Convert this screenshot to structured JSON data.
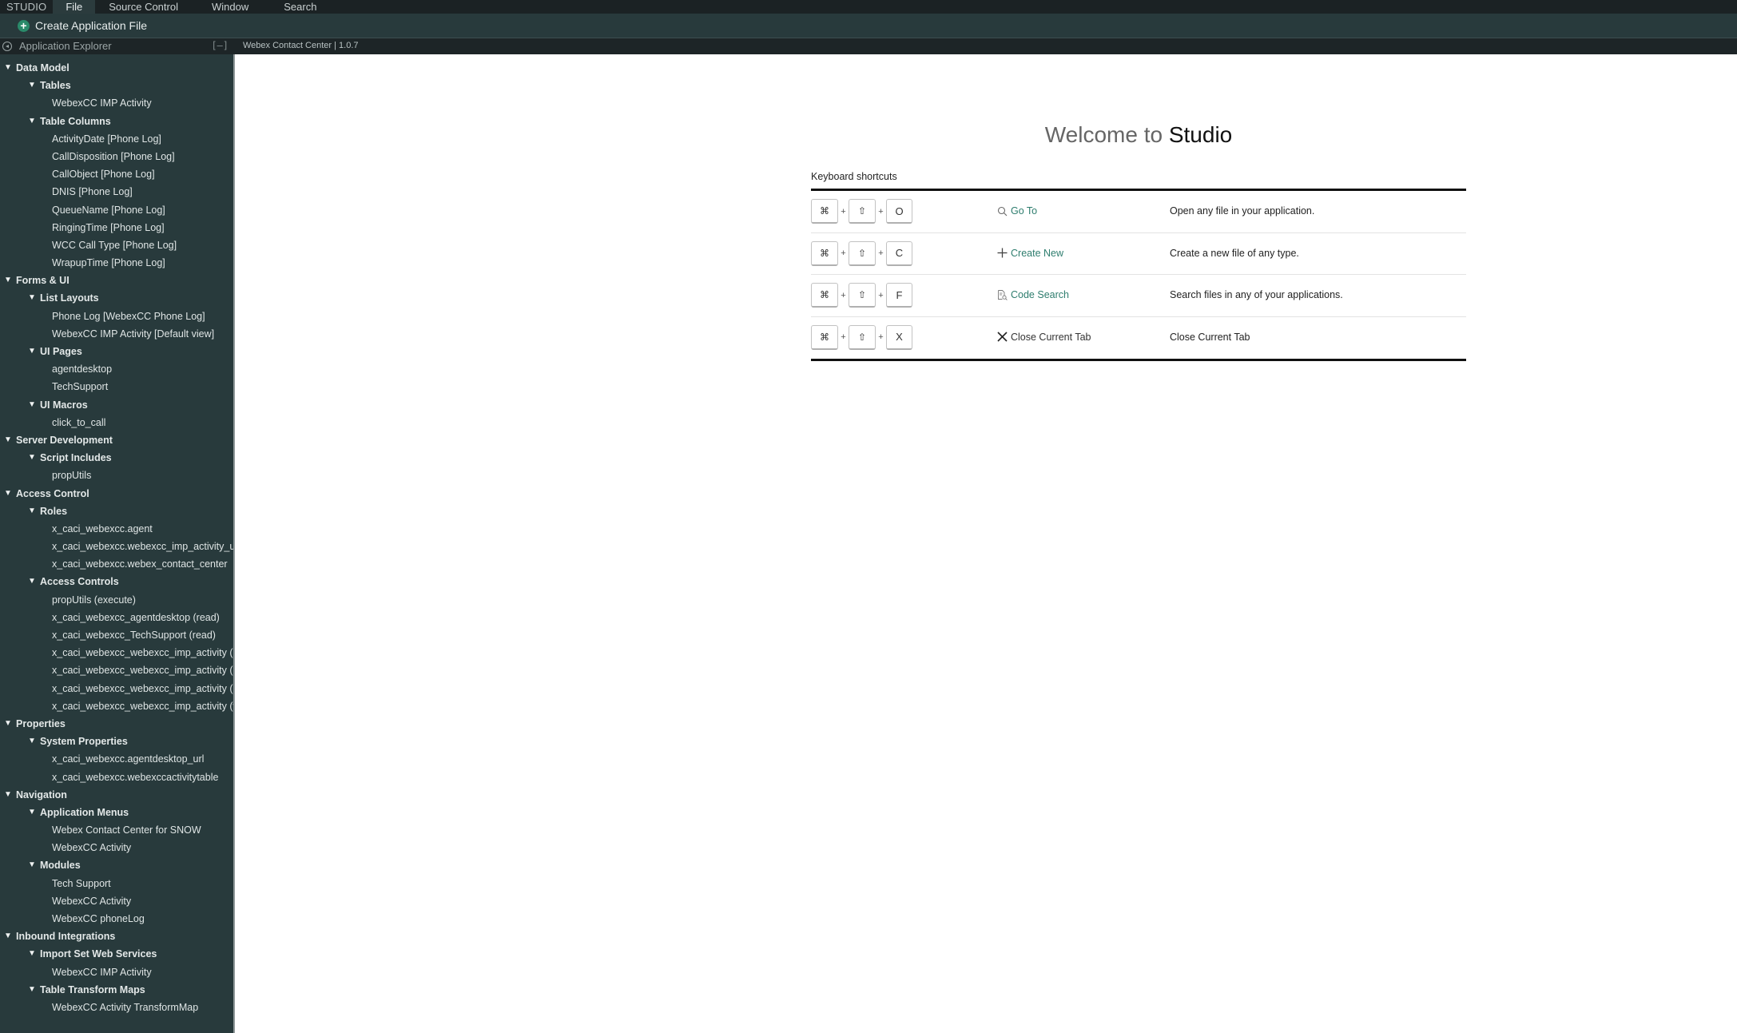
{
  "menubar": {
    "brand": "STUDIO",
    "items": [
      "File",
      "Source Control",
      "Window",
      "Search"
    ],
    "active": "File"
  },
  "toolbar": {
    "create_label": "Create Application File",
    "create_icon": "plus-circle-icon"
  },
  "explorer": {
    "title": "Application Explorer",
    "minimize_label": "[–]"
  },
  "tabbar": {
    "tabs": [
      {
        "label": "Webex Contact Center | 1.0.7"
      }
    ]
  },
  "tree": [
    {
      "level": 0,
      "label": "Data Model"
    },
    {
      "level": 1,
      "label": "Tables"
    },
    {
      "level": 2,
      "label": "WebexCC IMP Activity"
    },
    {
      "level": 1,
      "label": "Table Columns"
    },
    {
      "level": 2,
      "label": "ActivityDate [Phone Log]"
    },
    {
      "level": 2,
      "label": "CallDisposition [Phone Log]"
    },
    {
      "level": 2,
      "label": "CallObject [Phone Log]"
    },
    {
      "level": 2,
      "label": "DNIS [Phone Log]"
    },
    {
      "level": 2,
      "label": "QueueName [Phone Log]"
    },
    {
      "level": 2,
      "label": "RingingTime [Phone Log]"
    },
    {
      "level": 2,
      "label": "WCC Call Type [Phone Log]"
    },
    {
      "level": 2,
      "label": "WrapupTime [Phone Log]"
    },
    {
      "level": 0,
      "label": "Forms & UI"
    },
    {
      "level": 1,
      "label": "List Layouts"
    },
    {
      "level": 2,
      "label": "Phone Log [WebexCC Phone Log]"
    },
    {
      "level": 2,
      "label": "WebexCC IMP Activity [Default view]"
    },
    {
      "level": 1,
      "label": "UI Pages"
    },
    {
      "level": 2,
      "label": "agentdesktop"
    },
    {
      "level": 2,
      "label": "TechSupport"
    },
    {
      "level": 1,
      "label": "UI Macros"
    },
    {
      "level": 2,
      "label": "click_to_call"
    },
    {
      "level": 0,
      "label": "Server Development"
    },
    {
      "level": 1,
      "label": "Script Includes"
    },
    {
      "level": 2,
      "label": "propUtils"
    },
    {
      "level": 0,
      "label": "Access Control"
    },
    {
      "level": 1,
      "label": "Roles"
    },
    {
      "level": 2,
      "label": "x_caci_webexcc.agent"
    },
    {
      "level": 2,
      "label": "x_caci_webexcc.webexcc_imp_activity_us"
    },
    {
      "level": 2,
      "label": "x_caci_webexcc.webex_contact_center"
    },
    {
      "level": 1,
      "label": "Access Controls"
    },
    {
      "level": 2,
      "label": "propUtils (execute)"
    },
    {
      "level": 2,
      "label": "x_caci_webexcc_agentdesktop (read)"
    },
    {
      "level": 2,
      "label": "x_caci_webexcc_TechSupport (read)"
    },
    {
      "level": 2,
      "label": "x_caci_webexcc_webexcc_imp_activity (re"
    },
    {
      "level": 2,
      "label": "x_caci_webexcc_webexcc_imp_activity (de"
    },
    {
      "level": 2,
      "label": "x_caci_webexcc_webexcc_imp_activity (cr"
    },
    {
      "level": 2,
      "label": "x_caci_webexcc_webexcc_imp_activity (w"
    },
    {
      "level": 0,
      "label": "Properties"
    },
    {
      "level": 1,
      "label": "System Properties"
    },
    {
      "level": 2,
      "label": "x_caci_webexcc.agentdesktop_url"
    },
    {
      "level": 2,
      "label": "x_caci_webexcc.webexccactivitytable"
    },
    {
      "level": 0,
      "label": "Navigation"
    },
    {
      "level": 1,
      "label": "Application Menus"
    },
    {
      "level": 2,
      "label": "Webex Contact Center for SNOW"
    },
    {
      "level": 2,
      "label": "WebexCC Activity"
    },
    {
      "level": 1,
      "label": "Modules"
    },
    {
      "level": 2,
      "label": "Tech Support"
    },
    {
      "level": 2,
      "label": "WebexCC Activity"
    },
    {
      "level": 2,
      "label": "WebexCC phoneLog"
    },
    {
      "level": 0,
      "label": "Inbound Integrations"
    },
    {
      "level": 1,
      "label": "Import Set Web Services"
    },
    {
      "level": 2,
      "label": "WebexCC IMP Activity"
    },
    {
      "level": 1,
      "label": "Table Transform Maps"
    },
    {
      "level": 2,
      "label": "WebexCC Activity TransformMap"
    }
  ],
  "welcome": {
    "prefix": "Welcome to",
    "product": "Studio"
  },
  "shortcuts": {
    "label": "Keyboard shortcuts",
    "rows": [
      {
        "keys": [
          "⌘",
          "⇧",
          "O"
        ],
        "icon": "search-icon",
        "action": "Go To",
        "link": true,
        "description": "Open any file in your application."
      },
      {
        "keys": [
          "⌘",
          "⇧",
          "C"
        ],
        "icon": "plus-icon",
        "action": "Create New",
        "link": true,
        "description": "Create a new file of any type."
      },
      {
        "keys": [
          "⌘",
          "⇧",
          "F"
        ],
        "icon": "code-search-icon",
        "action": "Code Search",
        "link": true,
        "description": "Search files in any of your applications."
      },
      {
        "keys": [
          "⌘",
          "⇧",
          "X"
        ],
        "icon": "close-icon",
        "action": "Close Current Tab",
        "link": false,
        "description": "Close Current Tab"
      }
    ],
    "plus_sign": "+"
  },
  "colors": {
    "accent": "#2e7d6e",
    "sidebar_bg": "#283a3c",
    "menubar_bg": "#1b2224",
    "create_icon": "#2a8a6a"
  }
}
